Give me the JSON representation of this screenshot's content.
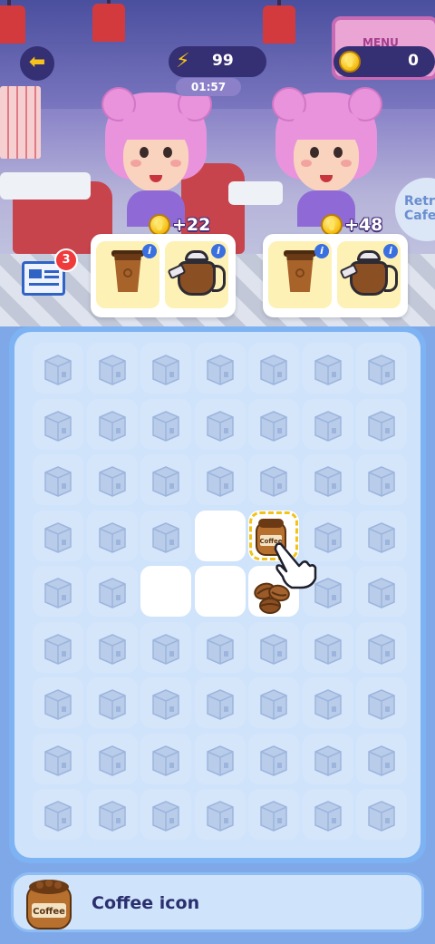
{
  "hud": {
    "back_icon": "arrow-left-icon",
    "energy_icon": "lightning-icon",
    "energy_value": "99",
    "timer": "01:57",
    "coin_icon": "coin-icon",
    "coin_value": "0"
  },
  "scene": {
    "menu_sign_text": "MENU",
    "cafe_sign_text": "Retro Cafe"
  },
  "news": {
    "icon": "newspaper-icon",
    "badge_count": "3"
  },
  "customers": [
    {
      "reward": "+22",
      "order_items": [
        {
          "item": "coffee-cup-icon",
          "info": "i"
        },
        {
          "item": "coffee-kettle-icon",
          "info": "i"
        }
      ]
    },
    {
      "reward": "+48",
      "order_items": [
        {
          "item": "coffee-cup-icon",
          "info": "i"
        },
        {
          "item": "coffee-kettle-icon",
          "info": "i"
        }
      ]
    }
  ],
  "board": {
    "rows": 9,
    "cols": 7,
    "open_cells": [
      [
        3,
        3
      ],
      [
        3,
        4
      ],
      [
        4,
        2
      ],
      [
        4,
        3
      ],
      [
        4,
        4
      ]
    ],
    "items": [
      {
        "row": 3,
        "col": 4,
        "item": "coffee-jar-icon",
        "label": "Coffee",
        "selected": true
      },
      {
        "row": 4,
        "col": 4,
        "item": "coffee-beans-icon"
      }
    ],
    "hint": "pointing-hand-icon"
  },
  "selected_info": {
    "icon": "coffee-jar-icon",
    "jar_label": "Coffee",
    "label": "Coffee icon"
  },
  "colors": {
    "board_frame": "#7db2f3",
    "board_bg": "#cfe3fb",
    "hud_bg": "#352f73",
    "accent_yellow": "#f5c21b"
  }
}
